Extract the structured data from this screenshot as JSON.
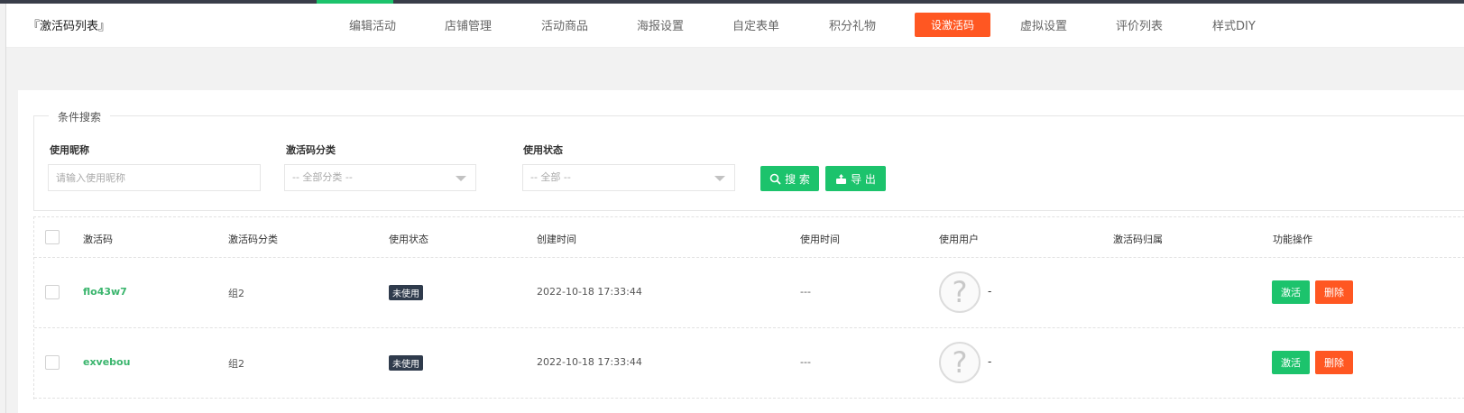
{
  "header": {
    "title": "『激活码列表』",
    "tabs": [
      {
        "label": "编辑活动"
      },
      {
        "label": "店铺管理"
      },
      {
        "label": "活动商品"
      },
      {
        "label": "海报设置"
      },
      {
        "label": "自定表单"
      },
      {
        "label": "积分礼物"
      },
      {
        "label": "设激活码",
        "active": true
      },
      {
        "label": "虚拟设置"
      },
      {
        "label": "评价列表"
      },
      {
        "label": "样式DIY"
      }
    ]
  },
  "search": {
    "legend": "条件搜索",
    "nickname_label": "使用昵称",
    "nickname_placeholder": "请输入使用昵称",
    "nickname_value": "",
    "category_label": "激活码分类",
    "category_selected": "-- 全部分类 --",
    "status_label": "使用状态",
    "status_selected": "-- 全部 --",
    "search_button": "搜 索",
    "export_button": "导 出"
  },
  "table": {
    "columns": [
      "激活码",
      "激活码分类",
      "使用状态",
      "创建时间",
      "使用时间",
      "使用用户",
      "激活码归属",
      "功能操作"
    ],
    "rows": [
      {
        "code": "flo43w7",
        "category": "组2",
        "status": "未使用",
        "created": "2022-10-18 17:33:44",
        "used_time": "---",
        "user": "-",
        "owner": "",
        "activate_label": "激活",
        "delete_label": "删除"
      },
      {
        "code": "exvebou",
        "category": "组2",
        "status": "未使用",
        "created": "2022-10-18 17:33:44",
        "used_time": "---",
        "user": "-",
        "owner": "",
        "activate_label": "激活",
        "delete_label": "删除"
      }
    ]
  },
  "colors": {
    "accent_green": "#1cc36c",
    "accent_orange": "#ff5722",
    "badge_dark": "#2f3b4c",
    "code_green": "#3ab56d"
  },
  "icons": {
    "search_button": "search-icon",
    "export_button": "export-icon",
    "avatar": "question-mark-avatar"
  }
}
